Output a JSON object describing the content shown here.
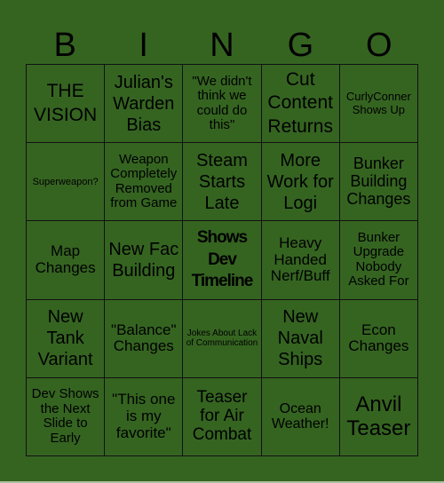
{
  "header": [
    "B",
    "I",
    "N",
    "G",
    "O"
  ],
  "cells": [
    [
      "THE VISION",
      "Julian's Warden Bias",
      "\"We didn't think we could do this\"",
      "Cut Content Returns",
      "CurlyConner Shows Up"
    ],
    [
      "Superweapon?",
      "Weapon Completely Removed from Game",
      "Steam Starts Late",
      "More Work for Logi",
      "Bunker Building Changes"
    ],
    [
      "Map Changes",
      "New Fac Building",
      "Shows Dev Timeline",
      "Heavy Handed Nerf/Buff",
      "Bunker Upgrade Nobody Asked For"
    ],
    [
      "New Tank Variant",
      "\"Balance\" Changes",
      "Jokes About Lack of Communication",
      "New Naval Ships",
      "Econ Changes"
    ],
    [
      "Dev Shows the Next Slide to Early",
      "\"This one is my favorite\"",
      "Teaser for Air Combat",
      "Ocean Weather!",
      "Anvil Teaser"
    ]
  ],
  "colors": {
    "background": "#356421",
    "grid_line": "#111111"
  }
}
